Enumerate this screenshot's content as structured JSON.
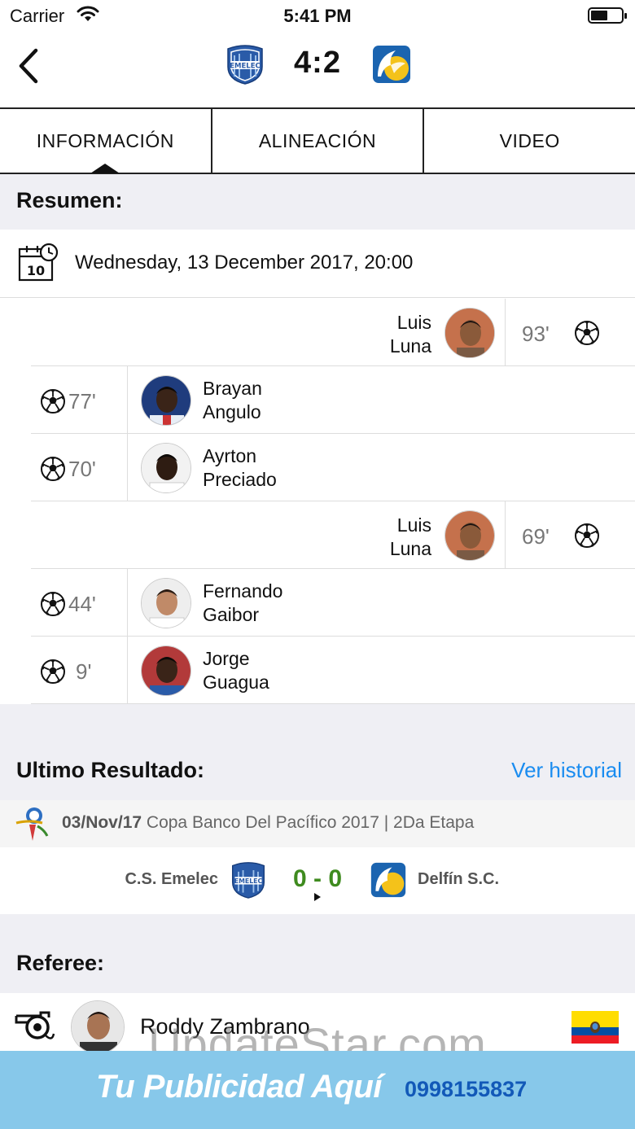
{
  "status_bar": {
    "carrier": "Carrier",
    "time": "5:41 PM"
  },
  "header": {
    "score": "4:2",
    "home_crest_icon": "emelec-crest-icon",
    "away_crest_icon": "delfin-crest-icon"
  },
  "tabs": [
    {
      "label": "INFORMACIÓN",
      "active": true
    },
    {
      "label": "ALINEACIÓN",
      "active": false
    },
    {
      "label": "VIDEO",
      "active": false
    }
  ],
  "summary": {
    "title": "Resumen:",
    "date_icon_day": "10",
    "date_text": "Wednesday, 13 December 2017, 20:00"
  },
  "events": [
    {
      "side": "away",
      "minute": "93'",
      "first": "Luis",
      "last": "Luna"
    },
    {
      "side": "home",
      "minute": "77'",
      "first": "Brayan",
      "last": "Angulo"
    },
    {
      "side": "home",
      "minute": "70'",
      "first": "Ayrton",
      "last": "Preciado"
    },
    {
      "side": "away",
      "minute": "69'",
      "first": "Luis",
      "last": "Luna"
    },
    {
      "side": "home",
      "minute": "44'",
      "first": "Fernando",
      "last": "Gaibor"
    },
    {
      "side": "home",
      "minute": "9'",
      "first": "Jorge",
      "last": "Guagua"
    }
  ],
  "last_result": {
    "title": "Ultimo Resultado:",
    "link": "Ver historial",
    "date": "03/Nov/17",
    "competition": "Copa Banco Del Pacífico 2017 | 2Da Etapa",
    "home_team": "C.S. Emelec",
    "away_team": "Delfín S.C.",
    "result": "0 - 0"
  },
  "referee": {
    "title": "Referee:",
    "name": "Roddy Zambrano",
    "flag": "ecuador-flag"
  },
  "watermark": "UpdateStar.com",
  "ad": {
    "slogan": "Tu Publicidad Aquí",
    "phone": "0998155837"
  },
  "colors": {
    "link_blue": "#1a8cf0",
    "result_green": "#3f8b1f",
    "section_bg": "#efeff4",
    "ad_bg": "#87c8ea",
    "ad_phone": "#1259b8"
  }
}
